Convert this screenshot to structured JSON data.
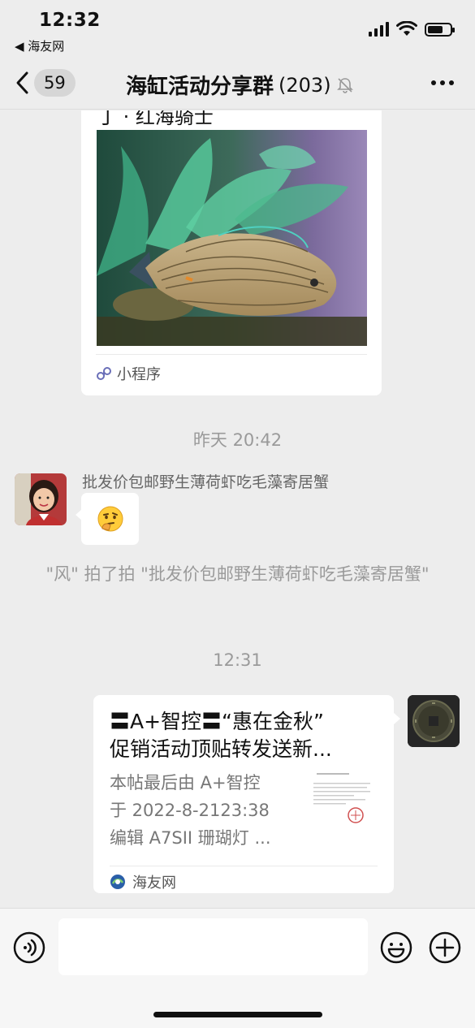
{
  "status_bar": {
    "time": "12:32",
    "back_to_app": "◀ 海友网",
    "battery_level": 0.7
  },
  "nav": {
    "unread_count": "59",
    "title": "海缸活动分享群",
    "member_count": "(203)",
    "icons": [
      "chevron-left-icon",
      "mute-bell-icon",
      "more-icon"
    ]
  },
  "messages": {
    "mini_program_card": {
      "title": "丁 · 红海骑士",
      "footer_label": "小程序",
      "icon": "mini-program-icon"
    },
    "timestamp_1": "昨天 20:42",
    "emoji_message": {
      "sender": "批发价包邮野生薄荷虾吃毛藻寄居蟹",
      "emoji": "thinking-face"
    },
    "pat_notice": "\"风\" 拍了拍 \"批发价包邮野生薄荷虾吃毛藻寄居蟹\"",
    "timestamp_2": "12:31",
    "article_card": {
      "title_line1": "〓A+智控〓“惠在金秋”",
      "title_line2": "促销活动顶贴转发送新...",
      "desc_line1": "本帖最后由 A+智控",
      "desc_line2": "于 2022-8-2123:38",
      "desc_line3": "编辑 A7SII 珊瑚灯 ...",
      "source": "海友网"
    }
  },
  "input_bar": {
    "placeholder": "",
    "icons": [
      "voice-icon",
      "emoji-icon",
      "plus-icon"
    ]
  },
  "colors": {
    "background": "#ededed",
    "bubble": "#ffffff",
    "meta_text": "#9a9a9a",
    "badge": "#d6d6d6"
  }
}
